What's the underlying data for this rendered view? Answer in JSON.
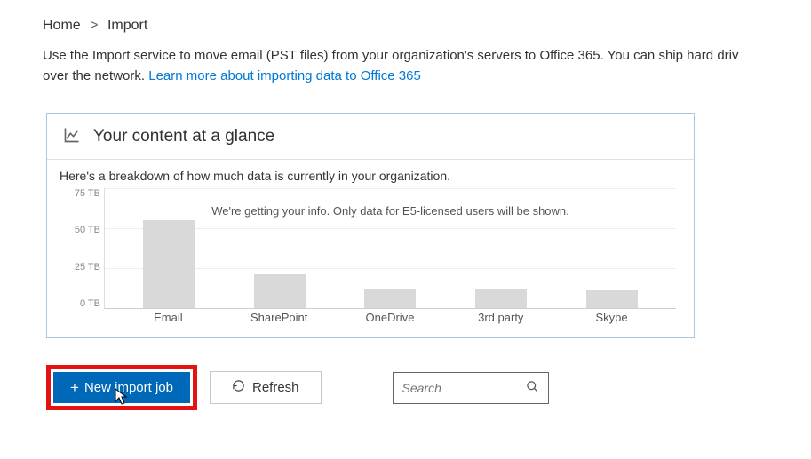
{
  "breadcrumb": {
    "home": "Home",
    "sep": ">",
    "current": "Import"
  },
  "description": {
    "text1": "Use the Import service to move email (PST files) from your organization's servers to Office 365. You can ship hard driv",
    "text2": "over the network. ",
    "link": "Learn more about importing data to Office 365"
  },
  "panel": {
    "title": "Your content at a glance",
    "subtext": "Here's a breakdown of how much data is currently in your organization.",
    "info_msg": "We're getting your info. Only data for E5-licensed users will be shown."
  },
  "toolbar": {
    "new_import": "New import job",
    "refresh": "Refresh",
    "search_placeholder": "Search"
  },
  "chart_data": {
    "type": "bar",
    "categories": [
      "Email",
      "SharePoint",
      "OneDrive",
      "3rd party",
      "Skype"
    ],
    "values": [
      55,
      21,
      12,
      12,
      11
    ],
    "title": "Your content at a glance",
    "xlabel": "",
    "ylabel": "",
    "y_ticks": [
      "75 TB",
      "50 TB",
      "25 TB",
      "0 TB"
    ],
    "ylim": [
      0,
      75
    ]
  }
}
